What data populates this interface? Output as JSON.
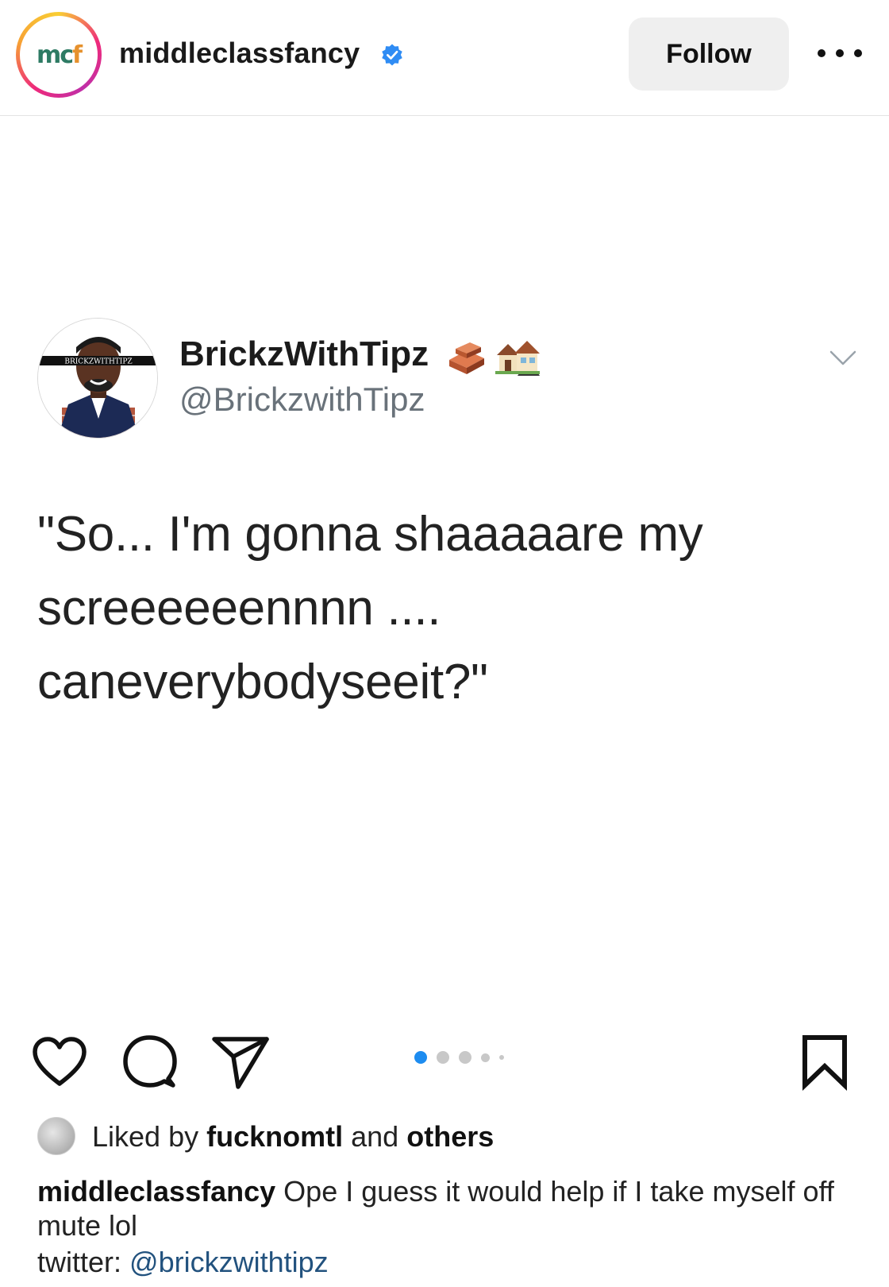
{
  "header": {
    "avatar_text_m": "mc",
    "avatar_text_f": "f",
    "username": "middleclassfancy",
    "follow_label": "Follow"
  },
  "tweet": {
    "display_name": "BrickzWithTipz",
    "handle": "@BrickzwithTipz",
    "avatar_banner": "BRICKZWITHTIPZ",
    "text": "\"So... I'm gonna shaaaaare my\nscreeeeeennnn ....\ncaneverybodyseeit?\""
  },
  "carousel": {
    "total": 5,
    "active": 1,
    "active_color": "#1d8cf0"
  },
  "likes": {
    "prefix": "Liked by",
    "liker": "fucknomtl",
    "middle": "and",
    "others": "others"
  },
  "caption": {
    "author": "middleclassfancy",
    "text": "Ope I guess it would help if I take myself off mute lol",
    "twitter_prefix": "twitter:",
    "twitter_handle": "@brickzwithtipz"
  },
  "colors": {
    "verified": "#2f8cf4",
    "follow_bg": "#efefef",
    "link": "#22527e"
  }
}
